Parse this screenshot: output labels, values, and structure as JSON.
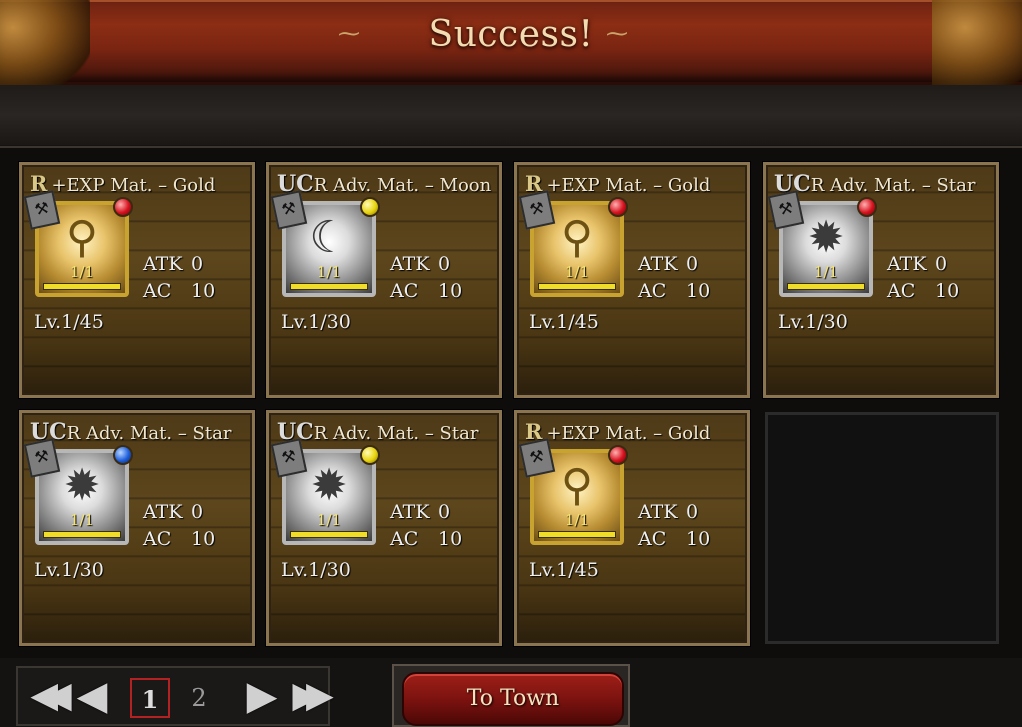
{
  "header": {
    "title": "Success!",
    "flourish": "⁓"
  },
  "cards": [
    {
      "rarity": "R",
      "name": "+EXP Mat. – Gold",
      "frame": "gold",
      "gem": "red",
      "glyph": "⚲",
      "count": "1/1",
      "atk_label": "ATK",
      "atk": "0",
      "ac_label": "AC",
      "ac": "10",
      "level": "Lv.1/45"
    },
    {
      "rarity": "UC",
      "name": "R Adv. Mat. – Moon",
      "frame": "silver",
      "gem": "yellow",
      "glyph": "☾",
      "count": "1/1",
      "atk_label": "ATK",
      "atk": "0",
      "ac_label": "AC",
      "ac": "10",
      "level": "Lv.1/30"
    },
    {
      "rarity": "R",
      "name": "+EXP Mat. – Gold",
      "frame": "gold",
      "gem": "red",
      "glyph": "⚲",
      "count": "1/1",
      "atk_label": "ATK",
      "atk": "0",
      "ac_label": "AC",
      "ac": "10",
      "level": "Lv.1/45"
    },
    {
      "rarity": "UC",
      "name": "R Adv. Mat. – Star",
      "frame": "silver",
      "gem": "red",
      "glyph": "✹",
      "count": "1/1",
      "atk_label": "ATK",
      "atk": "0",
      "ac_label": "AC",
      "ac": "10",
      "level": "Lv.1/30"
    },
    {
      "rarity": "UC",
      "name": "R Adv. Mat. – Star",
      "frame": "silver",
      "gem": "blue",
      "glyph": "✹",
      "count": "1/1",
      "atk_label": "ATK",
      "atk": "0",
      "ac_label": "AC",
      "ac": "10",
      "level": "Lv.1/30"
    },
    {
      "rarity": "UC",
      "name": "R Adv. Mat. – Star",
      "frame": "silver",
      "gem": "yellow",
      "glyph": "✹",
      "count": "1/1",
      "atk_label": "ATK",
      "atk": "0",
      "ac_label": "AC",
      "ac": "10",
      "level": "Lv.1/30"
    },
    {
      "rarity": "R",
      "name": "+EXP Mat. – Gold",
      "frame": "gold",
      "gem": "red",
      "glyph": "⚲",
      "count": "1/1",
      "atk_label": "ATK",
      "atk": "0",
      "ac_label": "AC",
      "ac": "10",
      "level": "Lv.1/45"
    }
  ],
  "pagination": {
    "first_icon": "◀◀",
    "prev_icon": "◀",
    "next_icon": "▶",
    "last_icon": "▶▶",
    "current_page": "1",
    "other_page": "2"
  },
  "footer": {
    "to_town_label": "To Town"
  },
  "colors": {
    "gem_red": "#d6121f",
    "gem_yellow": "#e8d30d",
    "gem_blue": "#1f5fdc",
    "button_red": "#7c1310"
  }
}
